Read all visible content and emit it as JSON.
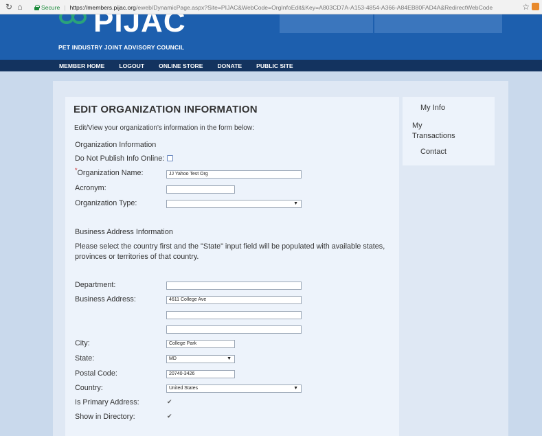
{
  "browser": {
    "secure_label": "Secure",
    "url_host": "https://members.pijac.org",
    "url_path": "/eweb/DynamicPage.aspx?Site=PIJAC&WebCode=OrgInfoEdit&Key=A803CD7A-A153-4854-A366-A84EB80FAD4A&RedirectWebCode"
  },
  "header": {
    "logo": "PIJAC",
    "org_name": "PET INDUSTRY JOINT ADVISORY COUNCIL"
  },
  "nav": [
    "MEMBER HOME",
    "LOGOUT",
    "ONLINE STORE",
    "DONATE",
    "PUBLIC SITE"
  ],
  "sidebar": [
    "My Info",
    "My Transactions",
    "Contact"
  ],
  "form": {
    "title": "EDIT ORGANIZATION INFORMATION",
    "intro": "Edit/View your organization's information in the form below:",
    "section_org": "Organization Information",
    "do_not_publish_label": "Do Not Publish Info Online:",
    "org_name_label": "Organization Name:",
    "org_name_value": "JJ Yahoo Test Org",
    "acronym_label": "Acronym:",
    "acronym_value": "",
    "org_type_label": "Organization Type:",
    "org_type_value": "",
    "section_address": "Business Address Information",
    "address_note": "Please select the country first and the \"State\" input field will be populated with available states, provinces or territories of that country.",
    "department_label": "Department:",
    "department_value": "",
    "address_label": "Business Address:",
    "address_line1": "4611 College Ave",
    "address_line2": "",
    "address_line3": "",
    "city_label": "City:",
    "city_value": "College Park",
    "state_label": "State:",
    "state_value": "MD",
    "postal_label": "Postal Code:",
    "postal_value": "20740-3426",
    "country_label": "Country:",
    "country_value": "United States",
    "primary_label": "Is Primary Address:",
    "directory_label": "Show in Directory:"
  }
}
